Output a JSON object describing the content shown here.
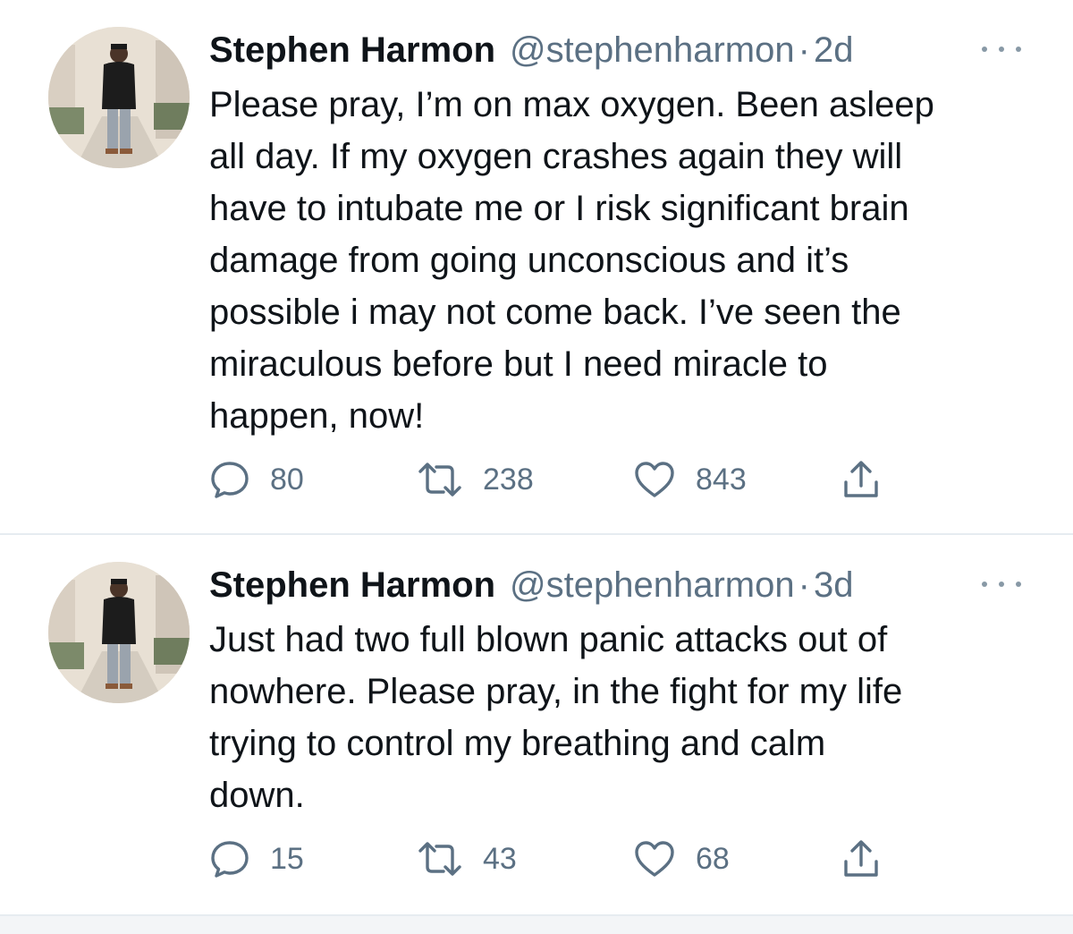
{
  "tweets": [
    {
      "name": "Stephen Harmon",
      "handle": "@stephenharmon",
      "separator": "·",
      "age": "2d",
      "text": "Please pray, I’m on max oxygen. Been asleep\nall day. If my oxygen crashes again they will\nhave to intubate me or I risk significant brain\ndamage from going unconscious and it’s\npossible i may not come back. I’ve seen the\nmiraculous before but I need miracle to\nhappen, now!",
      "replies": "80",
      "retweets": "238",
      "likes": "843"
    },
    {
      "name": "Stephen Harmon",
      "handle": "@stephenharmon",
      "separator": "·",
      "age": "3d",
      "text": "Just had two full blown panic attacks out of\nnowhere. Please pray, in the fight for my life\ntrying to control my breathing and calm\ndown.",
      "replies": "15",
      "retweets": "43",
      "likes": "68"
    }
  ],
  "icons": {
    "reply": "speech-bubble-icon",
    "retweet": "retweet-arrows-icon",
    "like": "heart-icon",
    "share": "share-upload-icon",
    "more": "more-dots-icon"
  },
  "colors": {
    "text": "#0f1419",
    "secondary": "#5b7083",
    "divider": "#e6ecf0"
  }
}
